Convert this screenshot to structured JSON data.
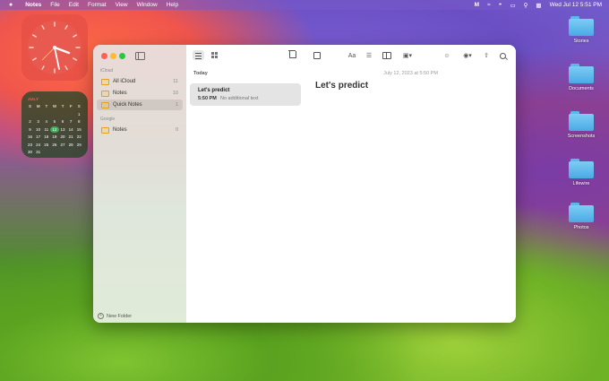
{
  "menubar": {
    "apple": "",
    "items": [
      "Notes",
      "File",
      "Edit",
      "Format",
      "View",
      "Window",
      "Help"
    ],
    "clock": "Wed Jul 12  5:51 PM"
  },
  "calendar": {
    "month": "JULY",
    "weekdays": [
      "S",
      "M",
      "T",
      "W",
      "T",
      "F",
      "S"
    ],
    "days": [
      "",
      "",
      "",
      "",
      "",
      "",
      "1",
      "2",
      "3",
      "4",
      "5",
      "6",
      "7",
      "8",
      "9",
      "10",
      "11",
      "12",
      "13",
      "14",
      "15",
      "16",
      "17",
      "18",
      "19",
      "20",
      "21",
      "22",
      "23",
      "24",
      "25",
      "26",
      "27",
      "28",
      "29",
      "30",
      "31"
    ],
    "today": "12"
  },
  "desktop_icons": [
    "Stories",
    "Documents",
    "Screenshots",
    "Lifewire",
    "Photos"
  ],
  "sidebar": {
    "sections": [
      {
        "header": "iCloud",
        "items": [
          {
            "label": "All iCloud",
            "count": "11"
          },
          {
            "label": "Notes",
            "count": "10"
          },
          {
            "label": "Quick Notes",
            "count": "1"
          }
        ]
      },
      {
        "header": "Google",
        "items": [
          {
            "label": "Notes",
            "count": "0"
          }
        ]
      }
    ],
    "new_folder": "New Folder"
  },
  "note_list": {
    "heading": "Today",
    "notes": [
      {
        "title": "Let's predict",
        "time": "5:50 PM",
        "preview": "No additional text"
      }
    ]
  },
  "editor": {
    "date": "July 12, 2023 at 5:50 PM",
    "title": "Let's predict",
    "format_label": "Aa"
  },
  "colors": {
    "close": "#ff5f57",
    "minimize": "#febc2e",
    "zoom": "#28c840",
    "folder_accent": "#e6a020"
  }
}
